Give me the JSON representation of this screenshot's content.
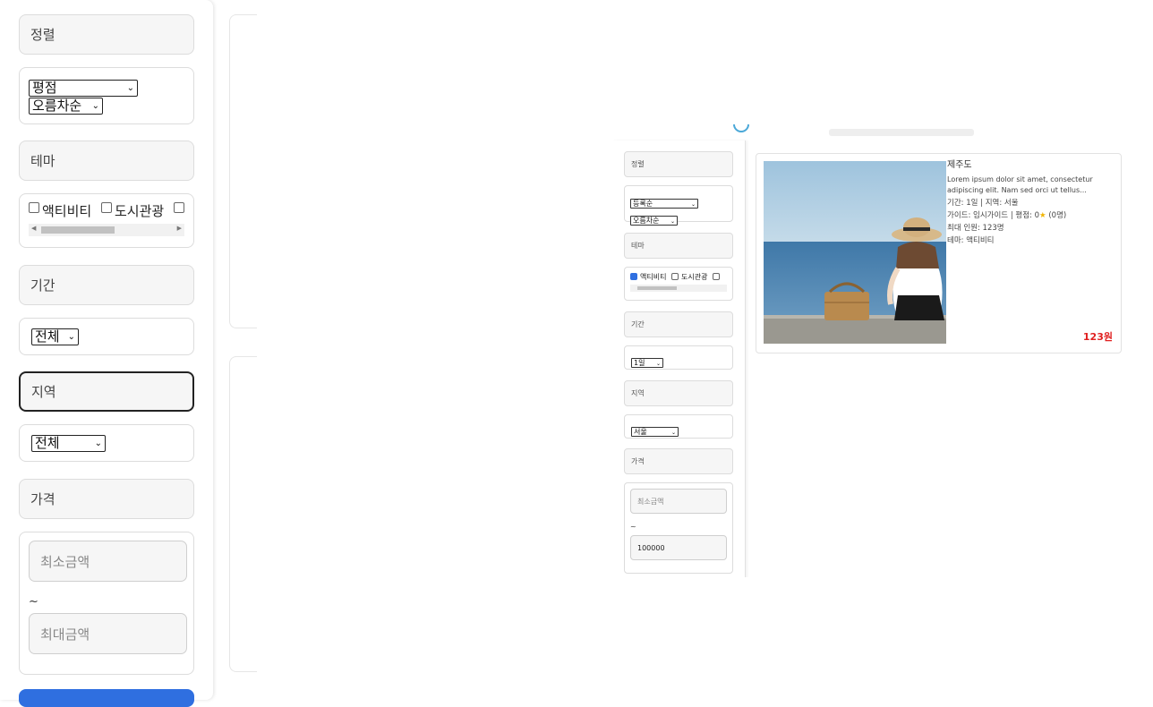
{
  "sidebar": {
    "sort_header": "정렬",
    "sort_select": "평점",
    "order_select": "오름차순",
    "theme_header": "테마",
    "themes": [
      {
        "label": "액티비티",
        "checked": false
      },
      {
        "label": "도시관광",
        "checked": false
      }
    ],
    "period_header": "기간",
    "period_select": "전체",
    "region_header": "지역",
    "region_select": "전체",
    "price_header": "가격",
    "min_price_placeholder": "최소금액",
    "tilde": "~",
    "max_price_placeholder": "최대금액"
  },
  "preview": {
    "sidebar": {
      "sort_header": "정렬",
      "sort_select": "등록순",
      "order_select": "오름차순",
      "theme_header": "테마",
      "themes": [
        {
          "label": "액티비티",
          "checked": true
        },
        {
          "label": "도시관광",
          "checked": false
        }
      ],
      "period_header": "기간",
      "period_select": "1일",
      "region_header": "지역",
      "region_select": "서울",
      "price_header": "가격",
      "min_price_placeholder": "최소금액",
      "tilde": "~",
      "max_price_value": "100000"
    },
    "card": {
      "title": "제주도",
      "description": "Lorem ipsum dolor sit amet, consectetur adipiscing elit. Nam sed orci ut tellus...",
      "period_region": "기간: 1일 | 지역: 서울",
      "guide_rating": "가이드: 임시가이드 | 평점: 0",
      "rating_count": "(0명)",
      "max_people": "최대 인원: 123명",
      "theme": "테마: 액티비티",
      "price": "123원",
      "star_icon": "star-icon",
      "star_color": "#f0b400"
    }
  },
  "colors": {
    "accent_blue": "#2f6fe0",
    "price_red": "#e02020"
  }
}
